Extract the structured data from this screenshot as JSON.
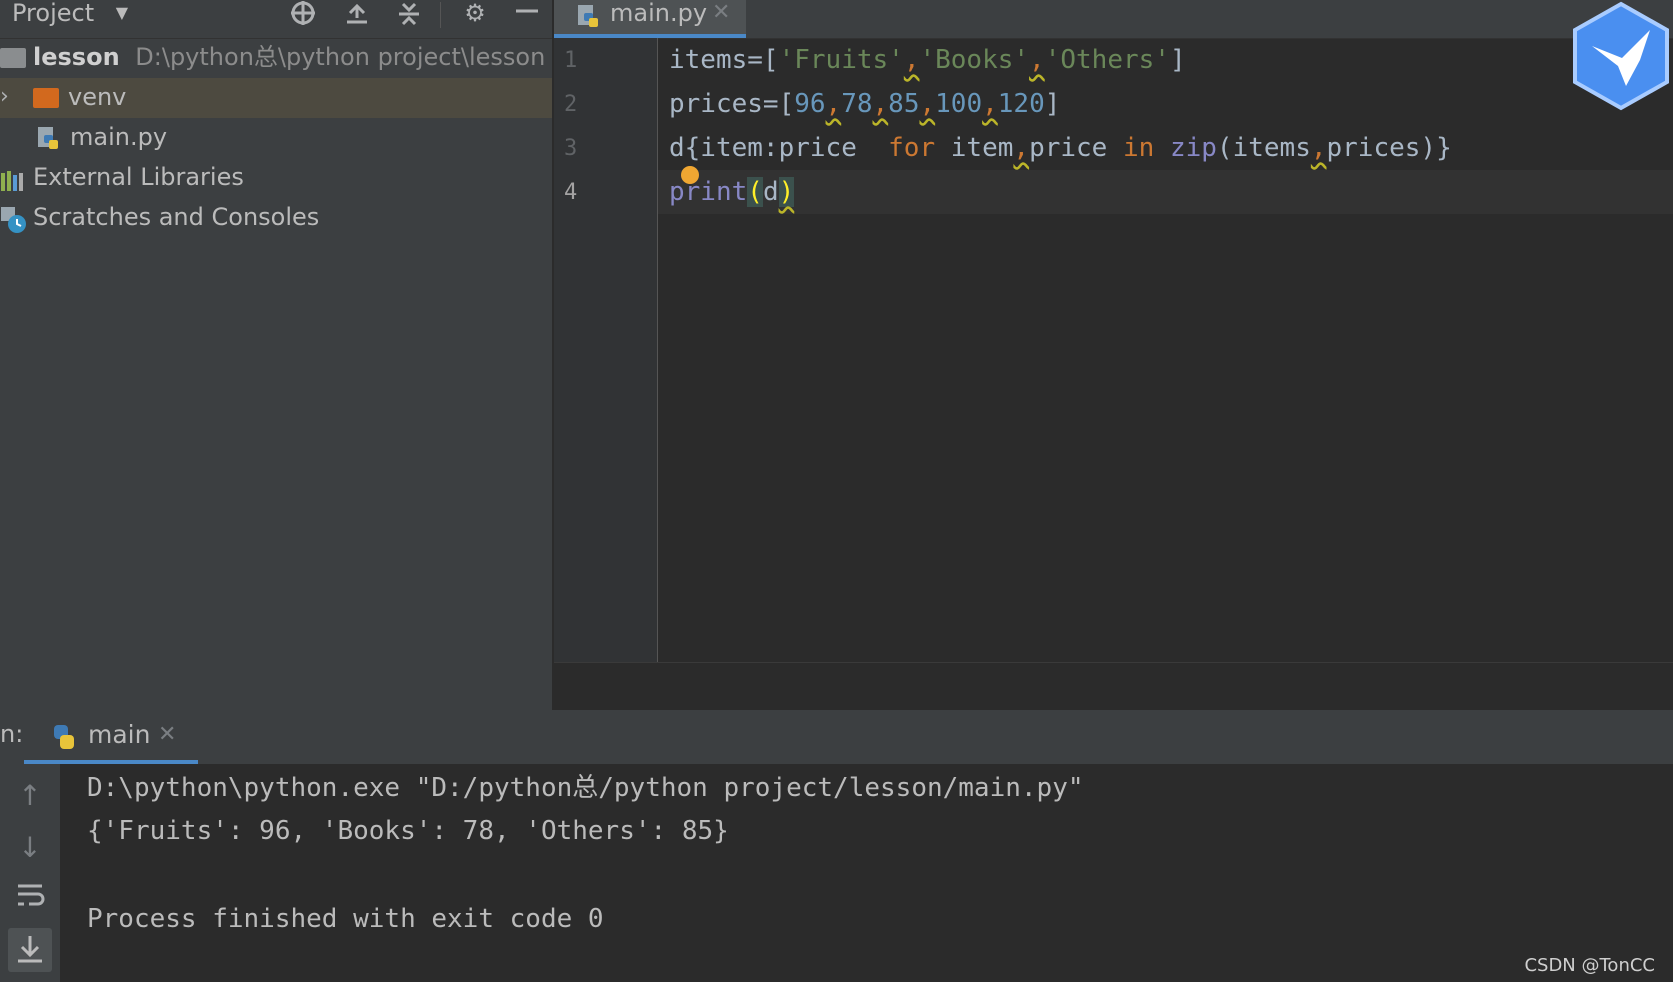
{
  "project_panel": {
    "title": "Project",
    "tree": {
      "root_name": "lesson",
      "root_path": "D:\\python总\\python project\\lesson",
      "venv": "venv",
      "main_file": "main.py",
      "external_libraries": "External Libraries",
      "scratches": "Scratches and Consoles"
    }
  },
  "editor": {
    "tab_label": "main.py",
    "line_numbers": [
      "1",
      "2",
      "3",
      "4"
    ],
    "code": {
      "l1": {
        "a": "items=[",
        "b": "'Fruits'",
        "c": ",",
        "d": "'Books'",
        "e": ",",
        "f": "'Others'",
        "g": "]"
      },
      "l2": {
        "a": "prices=[",
        "n1": "96",
        "n2": "78",
        "n3": "85",
        "n4": "100",
        "n5": "120",
        "c": ",",
        "z": "]"
      },
      "l3": {
        "a": "d",
        "b": "{item:price  ",
        "kw_for": "for",
        "c": " item",
        "d": ",",
        "e": "price ",
        "kw_in": "in",
        "sp": " ",
        "zip": "zip",
        "f": "(items",
        "g": ",",
        "h": "prices)}"
      },
      "l4": {
        "print": "print",
        "open": "(",
        "arg": "d",
        "close": ")"
      }
    }
  },
  "run_panel": {
    "prefix": "n:",
    "tab_label": "main",
    "output": [
      "D:\\python\\python.exe \"D:/python总/python project/lesson/main.py\"",
      "{'Fruits': 96, 'Books': 78, 'Others': 85}",
      "",
      "Process finished with exit code 0"
    ]
  },
  "watermark": "CSDN @TonCC",
  "colors": {
    "accent": "#4a88c7",
    "string": "#6a8759",
    "number": "#6897bb",
    "keyword": "#cc7832",
    "builtin": "#8888c6",
    "folder_venv": "#d2691e"
  },
  "icons": {
    "toolbar": [
      "locate-icon",
      "expand-all-icon",
      "collapse-all-icon",
      "gear-icon",
      "minimize-icon"
    ],
    "run_sidebar": [
      "arrow-up-icon",
      "arrow-down-icon",
      "soft-wrap-icon",
      "scroll-to-end-icon"
    ]
  }
}
